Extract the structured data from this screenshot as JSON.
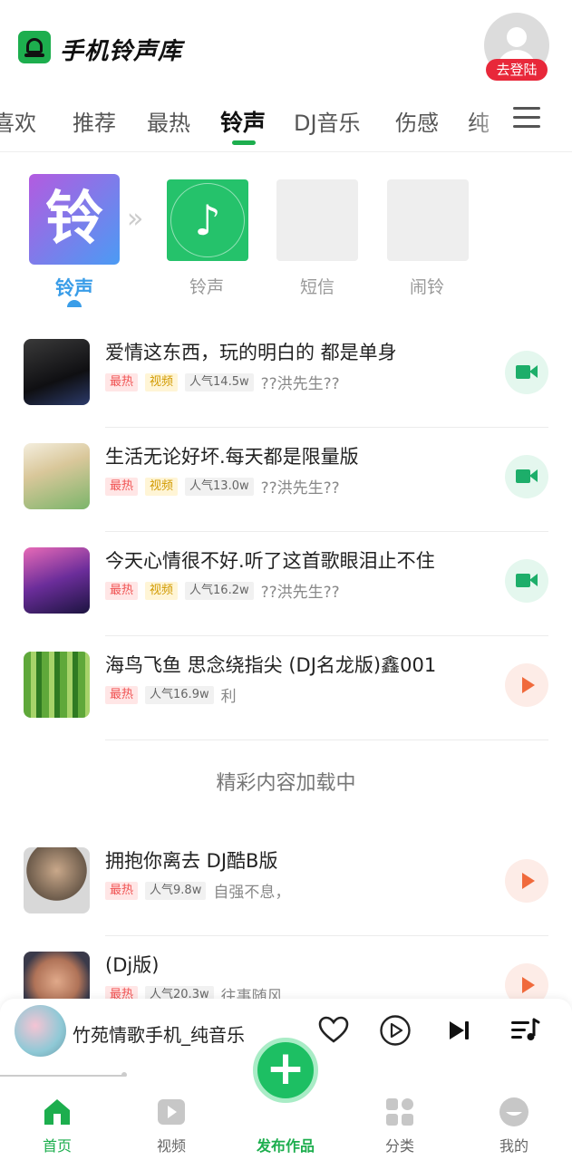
{
  "app": {
    "title": "手机铃声库",
    "login_badge": "去登陆"
  },
  "tabs": [
    {
      "label": "喜欢"
    },
    {
      "label": "推荐"
    },
    {
      "label": "最热"
    },
    {
      "label": "铃声",
      "active": true
    },
    {
      "label": "DJ音乐"
    },
    {
      "label": "伤感"
    },
    {
      "label": "纯"
    }
  ],
  "categories": {
    "main_icon_char": "铃",
    "chevron": "»",
    "items": [
      {
        "label": "铃声",
        "active": true
      },
      {
        "label": "铃声"
      },
      {
        "label": "短信"
      },
      {
        "label": "闹铃"
      }
    ]
  },
  "songs": [
    {
      "title": "爱情这东西，玩的明白的 都是单身",
      "tags": [
        "最热",
        "视频"
      ],
      "popularity": "人气14.5w",
      "author": "??洪先生??",
      "action": "video"
    },
    {
      "title": "生活无论好坏.每天都是限量版",
      "tags": [
        "最热",
        "视频"
      ],
      "popularity": "人气13.0w",
      "author": "??洪先生??",
      "action": "video"
    },
    {
      "title": "今天心情很不好.听了这首歌眼泪止不住",
      "tags": [
        "最热",
        "视频"
      ],
      "popularity": "人气16.2w",
      "author": "??洪先生??",
      "action": "video"
    },
    {
      "title": "海鸟飞鱼  思念绕指尖 (DJ名龙版)鑫001",
      "tags": [
        "最热"
      ],
      "popularity": "人气16.9w",
      "author": "利",
      "action": "play"
    },
    {
      "title": "拥抱你离去  DJ酷B版",
      "tags": [
        "最热"
      ],
      "popularity": "人气9.8w",
      "author": "自强不息，",
      "action": "play"
    },
    {
      "title": "(Dj版)",
      "tags": [
        "最热"
      ],
      "popularity": "人气20.3w",
      "author": "往事随风",
      "action": "play"
    }
  ],
  "loading_text": "精彩内容加载中",
  "player": {
    "title": "竹苑情歌手机_纯音乐",
    "icons": [
      "heart-icon",
      "play-circle-icon",
      "next-track-icon",
      "playlist-icon"
    ]
  },
  "nav": {
    "items": [
      {
        "label": "首页",
        "icon": "home-icon",
        "active": true
      },
      {
        "label": "视频",
        "icon": "video-icon"
      },
      {
        "label": "分类",
        "icon": "category-icon"
      },
      {
        "label": "我的",
        "icon": "profile-icon"
      }
    ],
    "publish_label": "发布作品",
    "publish_symbol": "+"
  },
  "colors": {
    "brand_green": "#1dae4e",
    "hot_red": "#f05454",
    "login_red": "#e8283a",
    "category_blue": "#3a9de8"
  }
}
